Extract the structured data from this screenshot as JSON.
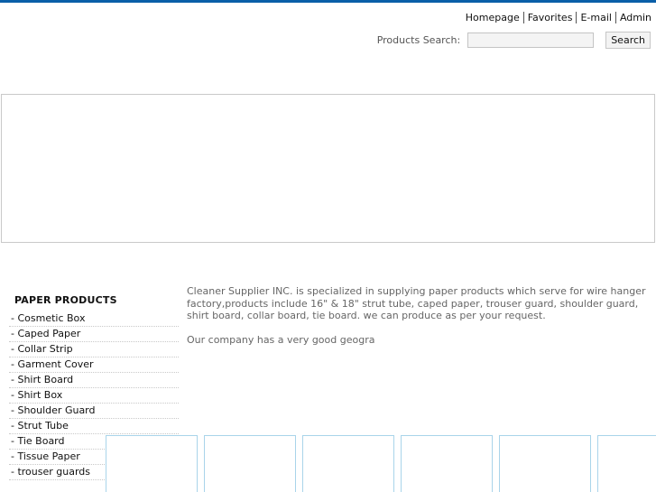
{
  "header": {
    "links": [
      "Homepage",
      "Favorites",
      "E-mail",
      "Admin"
    ],
    "search_label": "Products Search:",
    "search_value": "",
    "search_button": "Search"
  },
  "colors": {
    "top_bar": "#0a5fa8",
    "thumb_border": "#a9d4ea",
    "banner_border": "#c9c9c9"
  },
  "sidebar": {
    "title": "PAPER PRODUCTS",
    "items": [
      "- Cosmetic Box",
      "- Caped Paper",
      "- Collar Strip",
      "- Garment Cover",
      "- Shirt Board",
      "- Shirt Box",
      "- Shoulder Guard",
      "- Strut Tube",
      "- Tie Board",
      "- Tissue Paper",
      "- trouser guards"
    ]
  },
  "intro": {
    "paragraph_1": "Cleaner Supplier INC. is specialized in supplying paper products which serve for wire hanger factory,products include 16\" & 18\" strut tube, caped paper, trouser guard, shoulder guard, shirt board, collar board, tie board. we can produce as per your request.",
    "paragraph_2": "Our company has a very good geogra"
  }
}
